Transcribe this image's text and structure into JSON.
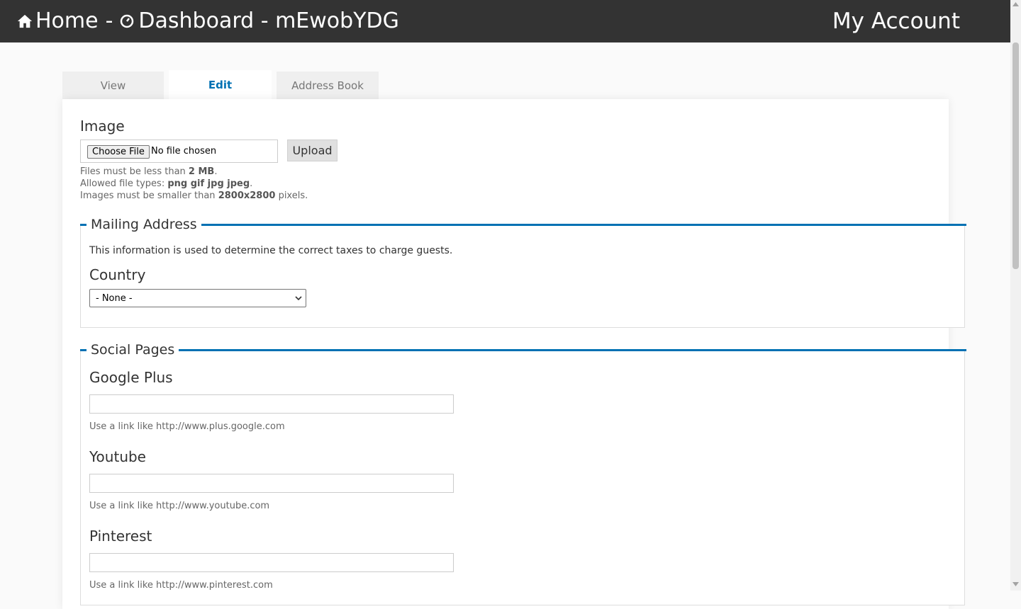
{
  "header": {
    "home_label": "Home",
    "separator": "-",
    "dashboard_label": "Dashboard - mEwobYDG",
    "account_label": "My Account"
  },
  "tabs": [
    {
      "label": "View"
    },
    {
      "label": "Edit"
    },
    {
      "label": "Address Book"
    }
  ],
  "image_section": {
    "title": "Image",
    "choose_file_label": "Choose File",
    "no_file_text": "No file chosen",
    "upload_label": "Upload",
    "help_size_prefix": "Files must be less than ",
    "help_size_value": "2 MB",
    "help_types_prefix": "Allowed file types: ",
    "help_types_value": "png gif jpg jpeg",
    "help_dims_prefix": "Images must be smaller than ",
    "help_dims_value": "2800x2800",
    "help_dims_suffix": " pixels."
  },
  "mailing": {
    "legend": "Mailing Address",
    "description": "This information is used to determine the correct taxes to charge guests.",
    "country_label": "Country",
    "country_value": "- None -"
  },
  "social": {
    "legend": "Social Pages",
    "fields": [
      {
        "label": "Google Plus",
        "value": "",
        "hint": "Use a link like http://www.plus.google.com"
      },
      {
        "label": "Youtube",
        "value": "",
        "hint": "Use a link like http://www.youtube.com"
      },
      {
        "label": "Pinterest",
        "value": "",
        "hint": "Use a link like http://www.pinterest.com"
      }
    ]
  },
  "colors": {
    "topbar": "#333333",
    "accent": "#0071b3"
  }
}
